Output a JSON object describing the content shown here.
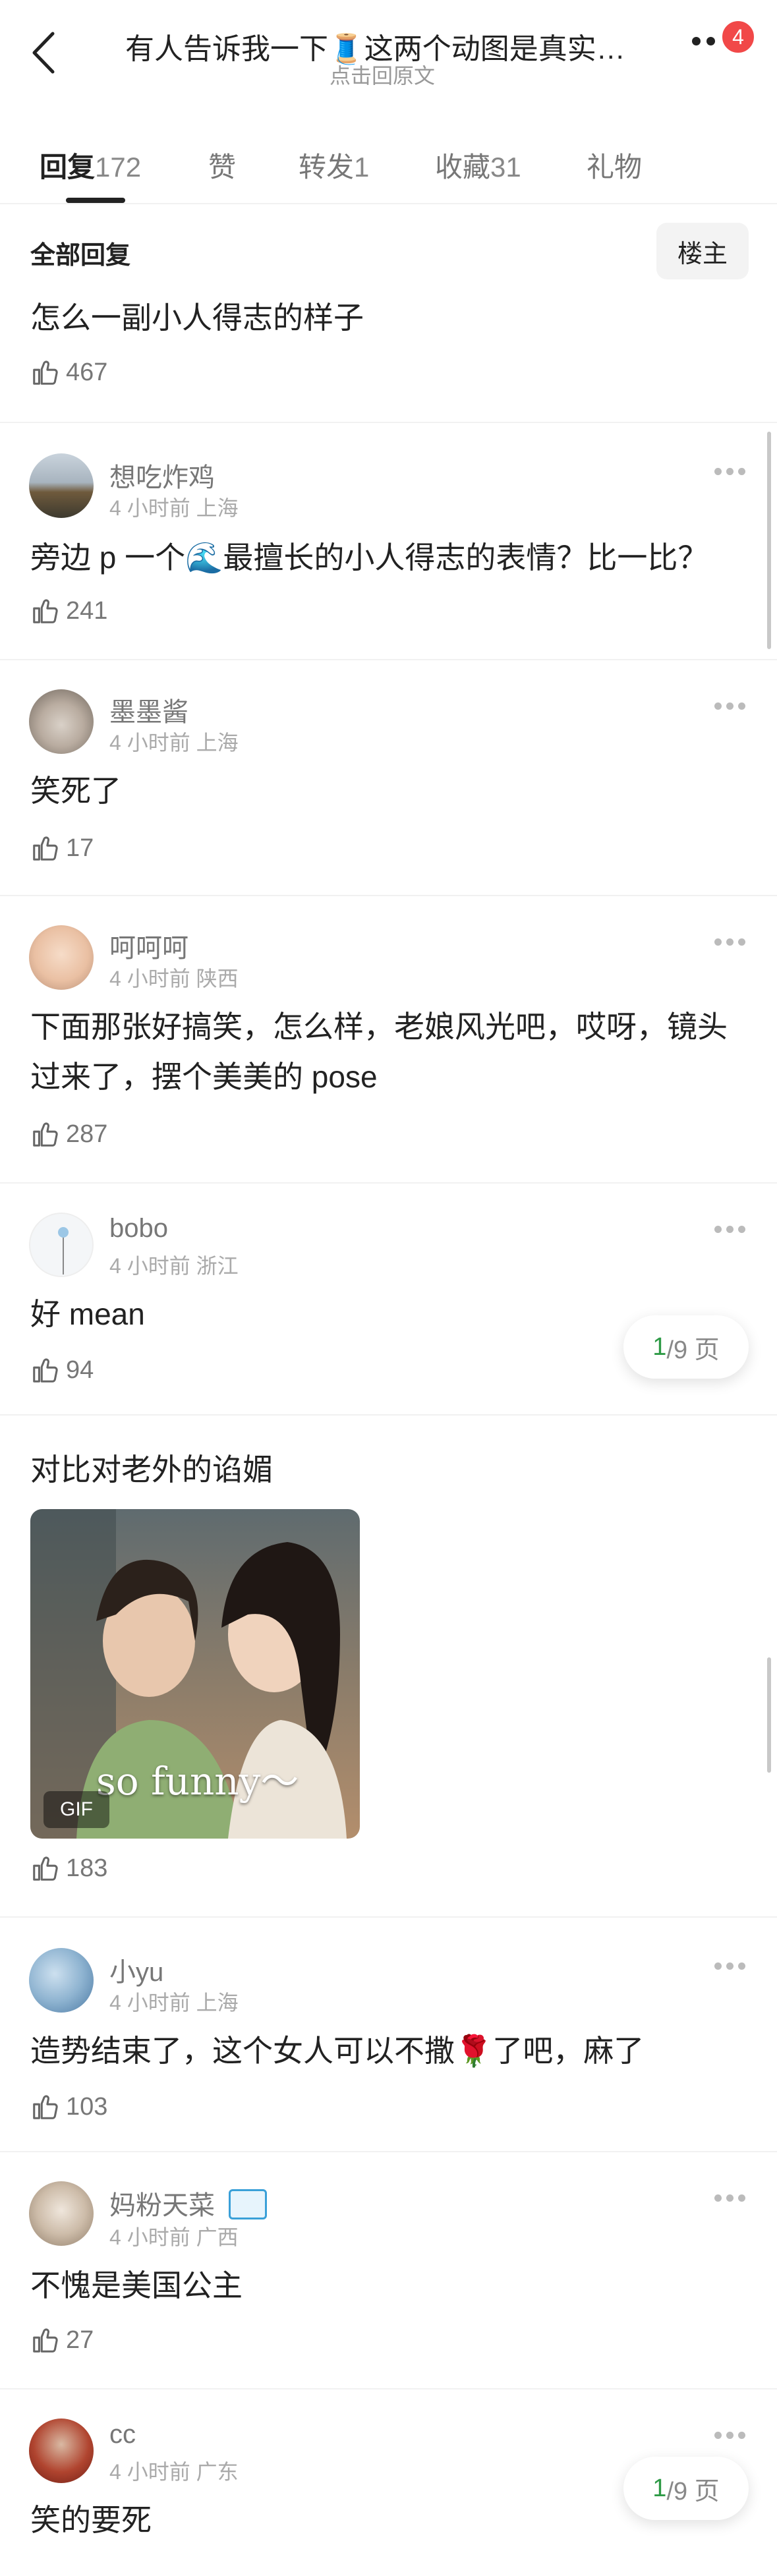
{
  "header": {
    "title": "有人告诉我一下🧵这两个动图是真实…",
    "subtitle": "点击回原文",
    "badge": "4"
  },
  "tabs": [
    {
      "label": "回复",
      "count": "172"
    },
    {
      "label": "赞",
      "count": ""
    },
    {
      "label": "转发",
      "count": "1"
    },
    {
      "label": "收藏",
      "count": "31"
    },
    {
      "label": "礼物",
      "count": ""
    }
  ],
  "filter": {
    "label": "全部回复",
    "owner": "楼主"
  },
  "pager": {
    "current": "1",
    "total": "/9 页"
  },
  "comments": [
    {
      "name": "",
      "meta": "",
      "text": "怎么一副小人得志的样子",
      "likes": "467"
    },
    {
      "name": "想吃炸鸡",
      "meta": "4 小时前 上海",
      "text": "旁边 p 一个🌊最擅长的小人得志的表情？比一比？",
      "likes": "241"
    },
    {
      "name": "墨墨酱",
      "meta": "4 小时前 上海",
      "text": "笑死了",
      "likes": "17"
    },
    {
      "name": "呵呵呵",
      "meta": "4 小时前 陕西",
      "text": "下面那张好搞笑，怎么样，老娘风光吧，哎呀，镜头过来了，摆个美美的 pose",
      "likes": "287"
    },
    {
      "name": "bobo",
      "meta": "4 小时前 浙江",
      "text": "好 mean",
      "likes": "94"
    },
    {
      "name": "",
      "meta": "",
      "text": "对比对老外的谄媚",
      "likes": "183",
      "gif_caption": "so funny～",
      "gif_tag": "GIF"
    },
    {
      "name": "小yu",
      "meta": "4 小时前 上海",
      "text": "造势结束了，这个女人可以不撒🌹了吧，麻了",
      "likes": "103"
    },
    {
      "name": "妈粉天菜",
      "meta": "4 小时前 广西",
      "text": "不愧是美国公主",
      "likes": "27"
    },
    {
      "name": "cc",
      "meta": "4 小时前 广东",
      "text": "笑的要死",
      "likes": ""
    }
  ]
}
